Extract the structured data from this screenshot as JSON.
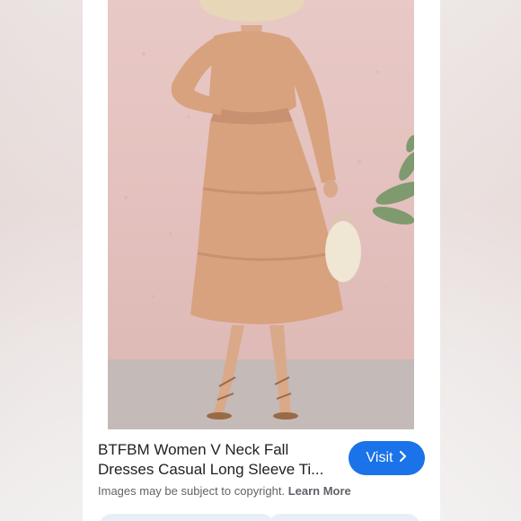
{
  "result": {
    "title_line1": "BTFBM Women V Neck Fall",
    "title_line2": "Dresses Casual Long Sleeve Ti...",
    "visit_label": "Visit",
    "copyright_prefix": "Images may be subject to copyright.",
    "learn_more": "Learn More"
  },
  "colors": {
    "visit_button": "#1a73e8",
    "dress": "#d8a27f",
    "wall": "#e4c1be"
  },
  "icons": {
    "visit_chevron": "chevron-right-icon"
  }
}
